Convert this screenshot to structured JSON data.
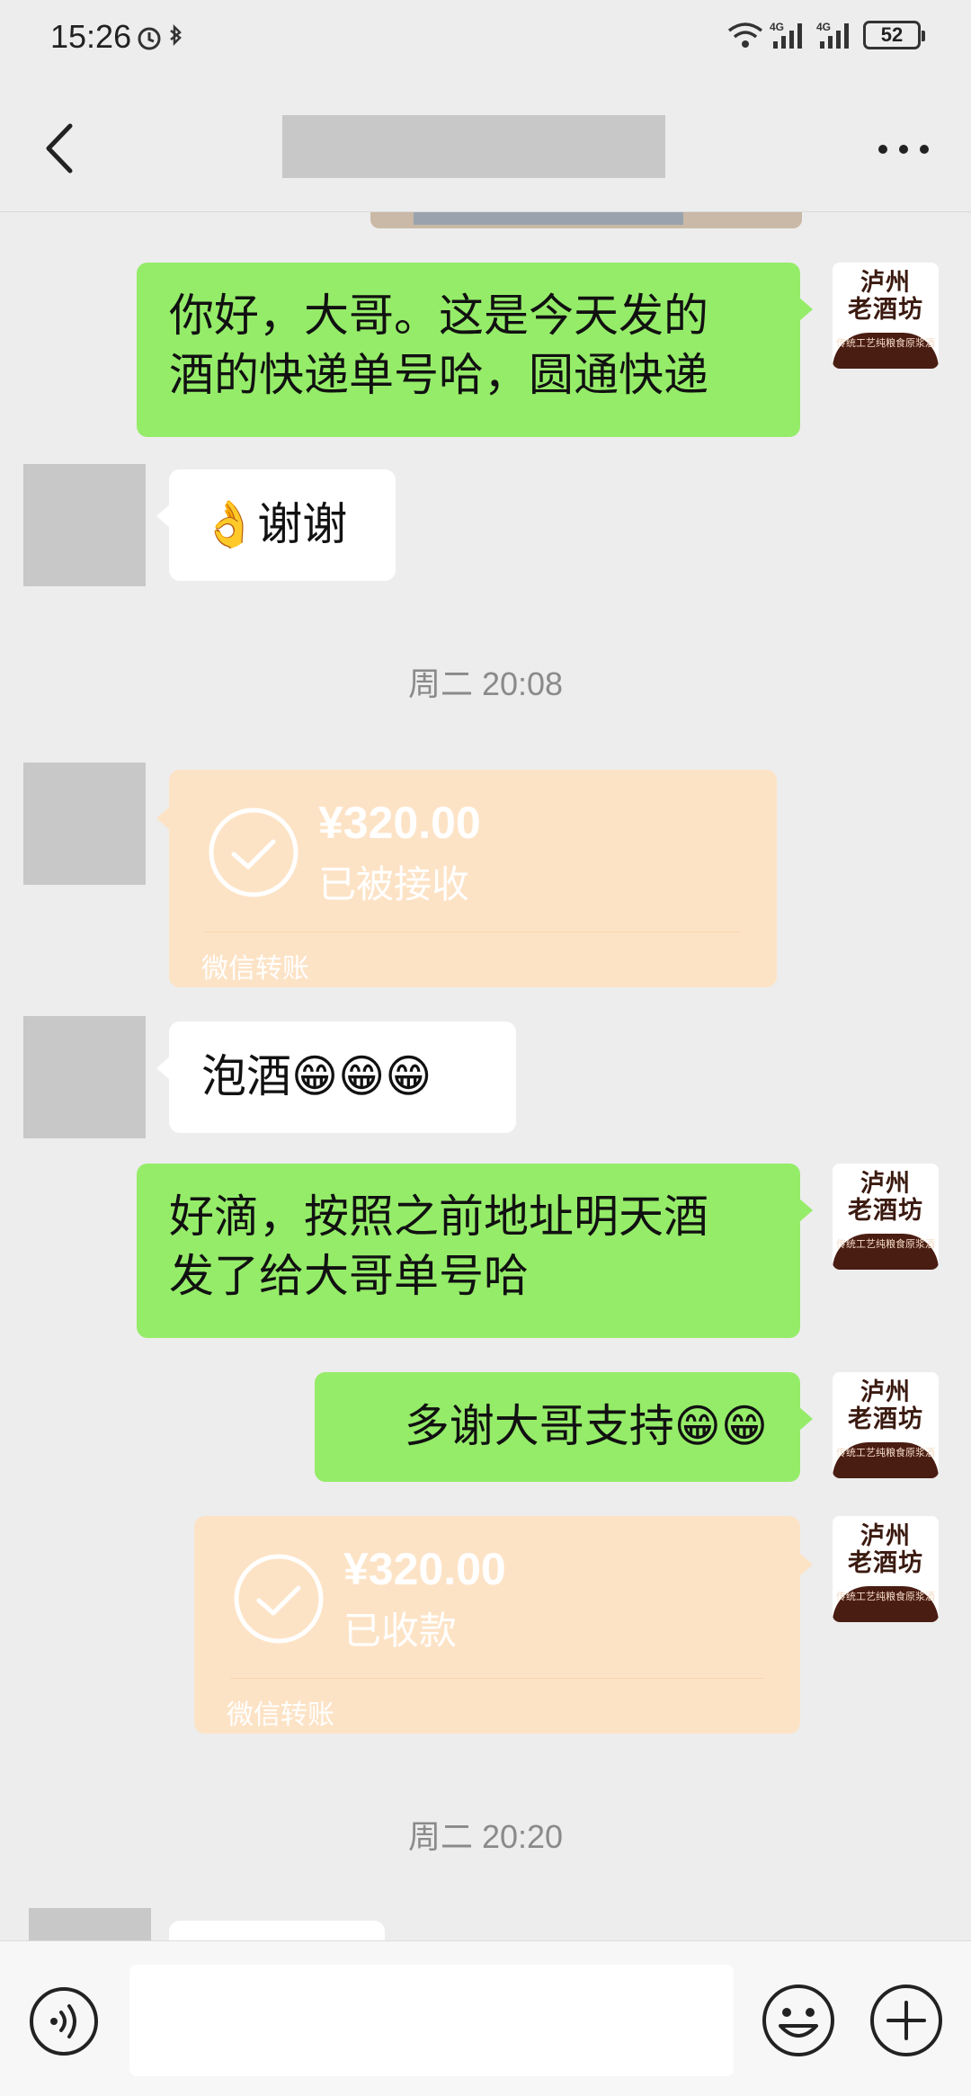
{
  "status": {
    "time": "15:26",
    "network_a": "4G",
    "network_b": "4G",
    "battery": "52"
  },
  "header": {
    "back_icon": "chevron-left-icon",
    "more_icon": "more-dots-icon"
  },
  "brand_avatar": {
    "line1": "泸州",
    "line2": "老酒坊",
    "foot": "传统工艺纯粮食原浆酒"
  },
  "messages": [
    {
      "side": "right",
      "type": "text",
      "text_line1": "你好，大哥。这是今天发的",
      "text_line2": "酒的快递单号哈，圆通快递"
    },
    {
      "side": "left",
      "type": "text",
      "text": "谢谢",
      "emoji": "👌"
    },
    {
      "type": "time",
      "text": "周二 20:08"
    },
    {
      "side": "left",
      "type": "transfer",
      "amount": "¥320.00",
      "status": "已被接收",
      "footer": "微信转账"
    },
    {
      "side": "left",
      "type": "text",
      "text": "泡酒",
      "emoji": "😁😁😁"
    },
    {
      "side": "right",
      "type": "text",
      "text_line1": "好滴，按照之前地址明天酒",
      "text_line2": "发了给大哥单号哈"
    },
    {
      "side": "right",
      "type": "text",
      "text": "多谢大哥支持",
      "emoji": "😁😁"
    },
    {
      "side": "right",
      "type": "transfer",
      "amount": "¥320.00",
      "status": "已收款",
      "footer": "微信转账"
    },
    {
      "type": "time",
      "text": "周二 20:20"
    }
  ],
  "input_bar": {
    "placeholder": "",
    "voice_icon": "voice-icon",
    "emoji_icon": "emoji-icon",
    "plus_icon": "plus-icon"
  },
  "colors": {
    "background": "#ededed",
    "green_bubble": "#95ec69",
    "transfer_bg": "#fde3c6",
    "brand_dark": "#4a1d12"
  }
}
